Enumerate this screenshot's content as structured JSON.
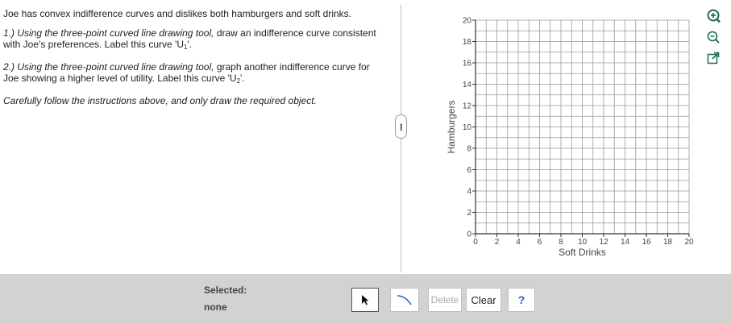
{
  "question": {
    "intro": "Joe has convex indifference curves and dislikes both hamburgers and soft drinks.",
    "step1": {
      "italic": "1.) Using the three-point curved line drawing tool,",
      "rest": " draw an indifference curve consistent with Joe's preferences. Label this curve 'U",
      "sub": "1",
      "end": "'."
    },
    "step2": {
      "italic": "2.) Using the three-point curved line drawing tool,",
      "rest": " graph another indifference curve for Joe showing a higher level of utility. Label this curve 'U",
      "sub": "2",
      "end": "'."
    },
    "note": "Carefully follow the instructions above, and only draw the required object."
  },
  "graph": {
    "xlabel": "Soft Drinks",
    "ylabel": "Hamburgers",
    "xlim": [
      0,
      20
    ],
    "ylim": [
      0,
      20
    ],
    "x_ticks": [
      "0",
      "2",
      "4",
      "6",
      "8",
      "10",
      "12",
      "14",
      "16",
      "18",
      "20"
    ],
    "y_ticks": [
      "0",
      "2",
      "4",
      "6",
      "8",
      "10",
      "12",
      "14",
      "16",
      "18",
      "20"
    ],
    "grid": true
  },
  "icons": {
    "zoom_in": "zoom-in-icon",
    "zoom_out": "zoom-out-icon",
    "popout": "popout-icon"
  },
  "toolbar": {
    "selected_label": "Selected:",
    "selected_value": "none",
    "delete_label": "Delete",
    "clear_label": "Clear",
    "help_label": "?"
  }
}
